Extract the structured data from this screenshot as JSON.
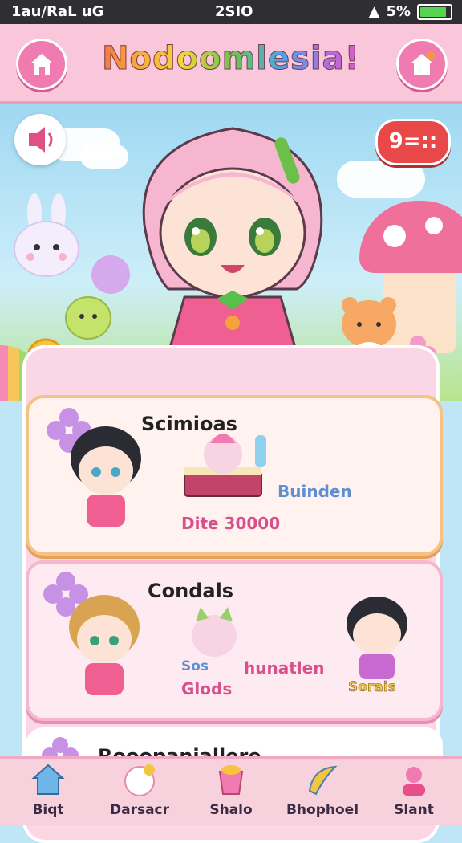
{
  "status_bar": {
    "left_text": "1au/RaL uG",
    "time": "2SIO",
    "battery_text": "5%",
    "battery_level": 0.95
  },
  "header": {
    "title": "Nodoomlesia!"
  },
  "hero": {
    "badge_text": "9=::"
  },
  "cards": [
    {
      "title": "Scimioas",
      "item_label": "Buinden",
      "price_label": "Dite 30000"
    },
    {
      "title": "Condals",
      "item_label_1": "Sos",
      "item_label_2": "Glods",
      "item_label_3": "hunatlen",
      "char_label": "Sorais"
    },
    {
      "title": "Rooopaniallere"
    }
  ],
  "nav": {
    "items": [
      {
        "label": "Biqt",
        "icon": "house-icon"
      },
      {
        "label": "Darsacr",
        "icon": "flower-face-icon"
      },
      {
        "label": "Shalo",
        "icon": "cup-icon"
      },
      {
        "label": "Bhophoel",
        "icon": "banana-icon"
      },
      {
        "label": "Slant",
        "icon": "character-icon"
      }
    ]
  },
  "colors": {
    "header_bg": "#f9c7d9",
    "accent_pink": "#f07bb0",
    "badge_red": "#e94848"
  }
}
